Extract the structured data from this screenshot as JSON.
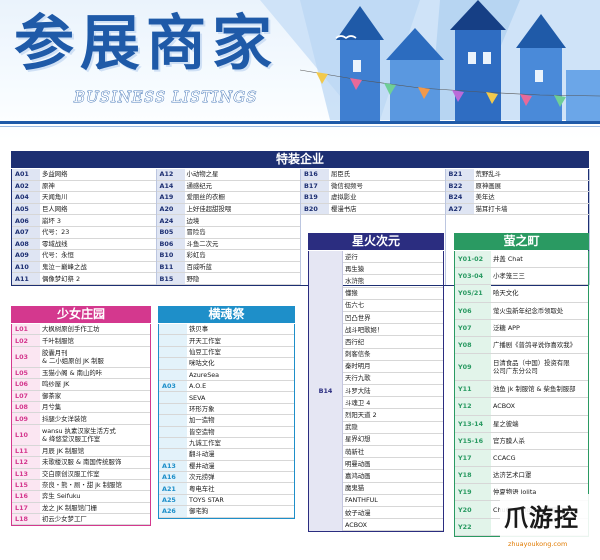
{
  "banner": {
    "title": "参展商家",
    "subtitle": "BUSINESS LISTINGS"
  },
  "sections": {
    "special": {
      "title": "特装企业",
      "color": "#1d2f72",
      "columns": [
        [
          {
            "code": "A01",
            "name": "多益网络"
          },
          {
            "code": "A02",
            "name": "原神"
          },
          {
            "code": "A04",
            "name": "天闻角川"
          },
          {
            "code": "A05",
            "name": "巨人网络"
          },
          {
            "code": "A06",
            "name": "崩坏 3"
          },
          {
            "code": "A07",
            "name": "代号：23"
          },
          {
            "code": "A08",
            "name": "零域战线"
          },
          {
            "code": "A09",
            "name": "代号：永恒"
          },
          {
            "code": "A10",
            "name": "鬼泣－巅峰之战"
          },
          {
            "code": "A11",
            "name": "偶像梦幻祭 2"
          }
        ],
        [
          {
            "code": "A12",
            "name": "小动物之星"
          },
          {
            "code": "A14",
            "name": "通感纪元"
          },
          {
            "code": "A19",
            "name": "爱丽丝的衣橱"
          },
          {
            "code": "A20",
            "name": "上好佳超甜投喂"
          },
          {
            "code": "A24",
            "name": "边境"
          },
          {
            "code": "B05",
            "name": "冒险岛"
          },
          {
            "code": "B06",
            "name": "斗鱼二次元"
          },
          {
            "code": "B10",
            "name": "彩虹岛"
          },
          {
            "code": "B11",
            "name": "百威听蓝"
          },
          {
            "code": "B15",
            "name": "野隐"
          }
        ],
        [
          {
            "code": "B16",
            "name": "屈臣氏"
          },
          {
            "code": "B17",
            "name": "微信视频号"
          },
          {
            "code": "B19",
            "name": "虚拟影业"
          },
          {
            "code": "B20",
            "name": "樱漫书店"
          }
        ],
        [
          {
            "code": "B21",
            "name": "荒野乱斗"
          },
          {
            "code": "B22",
            "name": "原神画展"
          },
          {
            "code": "B24",
            "name": "美年达"
          },
          {
            "code": "A27",
            "name": "猫耳打卡墙"
          }
        ]
      ]
    },
    "girls": {
      "title": "少女庄园",
      "color": "#d4388e",
      "rows": [
        {
          "code": "L01",
          "name": [
            "大枫树原创手作工坊"
          ]
        },
        {
          "code": "L02",
          "name": [
            "千叶制服馆"
          ]
        },
        {
          "code": "L03",
          "name": [
            "胶囊月刊",
            "& 二小姐原创 JK 制服"
          ]
        },
        {
          "code": "L05",
          "name": [
            "玉猫小阁 & 南山的咔"
          ]
        },
        {
          "code": "L06",
          "name": [
            "鸣纱屋 JK"
          ]
        },
        {
          "code": "L07",
          "name": [
            "御茶家"
          ]
        },
        {
          "code": "L08",
          "name": [
            "月兮集"
          ]
        },
        {
          "code": "L09",
          "name": [
            "抖腿少女洋装馆"
          ]
        },
        {
          "code": "L10",
          "name": [
            "wansu 执素汉家生活方式",
            "& 绛悠堂汉服工作室"
          ]
        },
        {
          "code": "L11",
          "name": [
            "月辰 JK 制服馆"
          ]
        },
        {
          "code": "L12",
          "name": [
            "未歌楼汉服 & 南国传统服饰"
          ]
        },
        {
          "code": "L13",
          "name": [
            "交白原创汉服工作室"
          ]
        },
        {
          "code": "L15",
          "name": [
            "奈良・熊・厕・甜 jk 制服馆"
          ]
        },
        {
          "code": "L16",
          "name": [
            "弈生 Seifuku"
          ]
        },
        {
          "code": "L17",
          "name": [
            "龙之 JK 制服馆门栅"
          ]
        },
        {
          "code": "L18",
          "name": [
            "初云少女梦工厂"
          ]
        }
      ]
    },
    "soul": {
      "title": "横魂祭",
      "color": "#1e8fc9",
      "rows": [
        {
          "code": "",
          "name": "铁贝事"
        },
        {
          "code": "",
          "name": "开天工作室"
        },
        {
          "code": "",
          "name": "仙豆工作室"
        },
        {
          "code": "",
          "name": "咪咕文化"
        },
        {
          "code": "",
          "name": "AzureSea"
        },
        {
          "code": "A03",
          "name": "A.O.E"
        },
        {
          "code": "",
          "name": "SEVA"
        },
        {
          "code": "",
          "name": "环形万象"
        },
        {
          "code": "",
          "name": "加一造物"
        },
        {
          "code": "",
          "name": "皆空造物"
        },
        {
          "code": "",
          "name": "九诚工作室"
        },
        {
          "code": "",
          "name": "翻斗动漫"
        },
        {
          "code": "A13",
          "name": "樱井动漫"
        },
        {
          "code": "A16",
          "name": "次元捞弹"
        },
        {
          "code": "A21",
          "name": "粤电车社"
        },
        {
          "code": "A25",
          "name": "TOYS STAR"
        },
        {
          "code": "A26",
          "name": "御宅狗"
        }
      ]
    },
    "spark": {
      "title": "星火次元",
      "color": "#2b2d80",
      "code": "B14",
      "items": [
        "逆行",
        "再生猿",
        "水浒熊",
        "懂猴",
        "伍六七",
        "凹凸世界",
        "战斗吧歌姬！",
        "西行纪",
        "刺客信条",
        "秦时明月",
        "天行九歌",
        "斗罗大陆",
        "斗魂卫 4",
        "烈阳天道 2",
        "武隐",
        "星界幻想",
        "萌新社",
        "明曼动画",
        "嘉鸿动画",
        "魔鬼猫",
        "FANTHFUL",
        "蚊子动漫",
        "ACBOX"
      ]
    },
    "firefly": {
      "title": "萤之町",
      "color": "#2a9a62",
      "rows": [
        {
          "code": "Y01-02",
          "name": [
            "井盖 Chat"
          ]
        },
        {
          "code": "Y03-04",
          "name": [
            "小孝笼三三"
          ]
        },
        {
          "code": "Y05/21",
          "name": [
            "哈天文化"
          ]
        },
        {
          "code": "Y06",
          "name": [
            "萤火虫新年纪念币领取处"
          ]
        },
        {
          "code": "Y07",
          "name": [
            "泛糖 APP"
          ]
        },
        {
          "code": "Y08",
          "name": [
            "广播剧《普鸽寻说你喜欢我》"
          ]
        },
        {
          "code": "Y09",
          "name": [
            "日清食品（中国）投资有限",
            "公司广东分公司"
          ]
        },
        {
          "code": "Y11",
          "name": [
            "池鱼 jk 制服馆 & 柴鱼制服部"
          ]
        },
        {
          "code": "Y12",
          "name": [
            "ACBOX"
          ]
        },
        {
          "code": "Y13-14",
          "name": [
            "星之彼端"
          ]
        },
        {
          "code": "Y15-16",
          "name": [
            "官方膜人杀"
          ]
        },
        {
          "code": "Y17",
          "name": [
            "CCACG"
          ]
        },
        {
          "code": "Y18",
          "name": [
            "达济艺术口罩"
          ]
        },
        {
          "code": "Y19",
          "name": [
            "仲夏物语 lolita"
          ]
        },
        {
          "code": "Y20",
          "name": [
            "ChuChuAngel 天使同萌"
          ]
        },
        {
          "code": "Y22",
          "name": [
            ""
          ]
        }
      ]
    }
  },
  "watermark": {
    "title": "爪游控",
    "url": "zhuayoukong.com"
  }
}
